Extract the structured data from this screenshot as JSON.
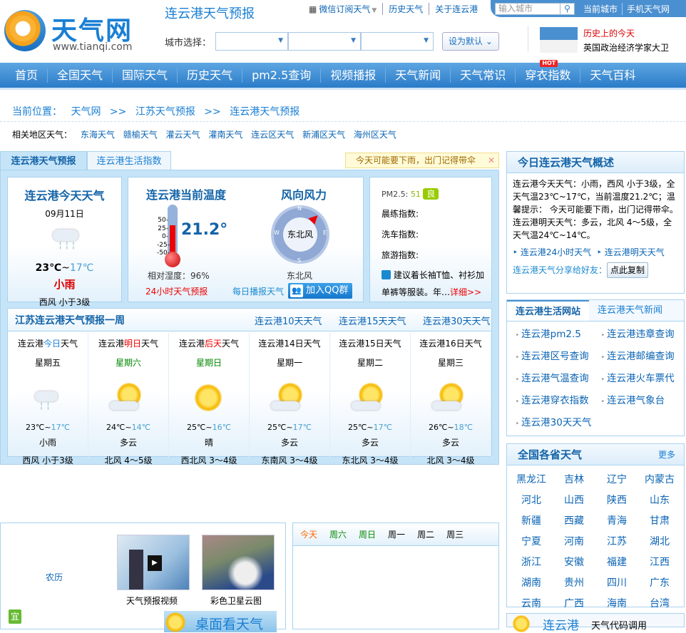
{
  "header": {
    "logo_text": "天气网",
    "logo_url": "www.tianqi.com",
    "title": "连云港天气预报",
    "top_links": [
      "微信订阅天气",
      "历史天气",
      "关于连云港"
    ],
    "search_placeholder": "输入城市",
    "current_city": "当前城市",
    "mobile": "手机天气网",
    "city_select_label": "城市选择：",
    "set_default": "设为默认",
    "history_title": "历史上的今天",
    "history_text": "英国政治经济学家大卫"
  },
  "nav": [
    "首页",
    "全国天气",
    "国际天气",
    "历史天气",
    "pm2.5查询",
    "视频播报",
    "天气新闻",
    "天气常识",
    "穿衣指数",
    "天气百科"
  ],
  "nav_hot": "HOT",
  "breadcrumb": {
    "label": "当前位置：",
    "items": [
      "天气网",
      ">>",
      "江苏天气预报",
      ">>",
      "连云港天气预报"
    ]
  },
  "related": {
    "label": "相关地区天气：",
    "items": [
      "东海天气",
      "赣榆天气",
      "灌云天气",
      "灌南天气",
      "连云区天气",
      "新浦区天气",
      "海州区天气"
    ]
  },
  "tabs": [
    "连云港天气预报",
    "连云港生活指数"
  ],
  "tip": "今天可能要下雨，出门记得带伞",
  "today": {
    "title": "连云港今天天气",
    "date": "09月11日",
    "high": "23℃",
    "sep": "~",
    "low": "17℃",
    "condition": "小雨",
    "wind": "西风 小于3级"
  },
  "current": {
    "title": "连云港当前温度",
    "temp": "21.2°",
    "scale": [
      "50-",
      "25-",
      "0-",
      "-25-",
      "-50-"
    ],
    "humidity": "相对湿度：96%",
    "link24": "24小时天气预报",
    "temp_fill": 0.6
  },
  "wind": {
    "title": "风向风力",
    "compass_n": "N",
    "compass_e": "E",
    "compass_s": "S",
    "compass_w": "W",
    "dir": "东北风",
    "label": "东北风",
    "daily": "每日播报天气",
    "qq": "加入QQ群"
  },
  "index": {
    "pm_label": "PM2.5:",
    "pm_value": "51",
    "pm_grade": "良",
    "items": [
      "晨练指数:",
      "洗车指数:",
      "旅游指数:"
    ],
    "dress": "建议着长袖T恤、衬衫加单裤等服装。年…",
    "detail": "详细>>"
  },
  "week": {
    "title": "江苏连云港天气预报一周",
    "links": [
      "连云港10天天气",
      "连云港15天天气",
      "连云港30天天气"
    ],
    "days": [
      {
        "pre": "连云港",
        "hl": "今日",
        "post": "天气",
        "hlcolor": "#1a7fd4",
        "weekday": "星期五",
        "wdcolor": "#000",
        "high": "23℃",
        "low": "17℃",
        "cond": "小雨",
        "wind": "西风 小于3级",
        "icon": "rain"
      },
      {
        "pre": "连云港",
        "hl": "明日",
        "post": "天气",
        "hlcolor": "#e00",
        "weekday": "星期六",
        "wdcolor": "#080",
        "high": "24℃",
        "low": "14℃",
        "cond": "多云",
        "wind": "北风 4～5级",
        "icon": "cloudy"
      },
      {
        "pre": "连云港",
        "hl": "后天",
        "post": "天气",
        "hlcolor": "#e00",
        "weekday": "星期日",
        "wdcolor": "#080",
        "high": "25℃",
        "low": "16℃",
        "cond": "晴",
        "wind": "西北风 3～4级",
        "icon": "sun"
      },
      {
        "pre": "连云港",
        "hl": "14日",
        "post": "天气",
        "hlcolor": "#000",
        "weekday": "星期一",
        "wdcolor": "#000",
        "high": "25℃",
        "low": "17℃",
        "cond": "多云",
        "wind": "东南风 3～4级",
        "icon": "cloudy"
      },
      {
        "pre": "连云港",
        "hl": "15日",
        "post": "天气",
        "hlcolor": "#000",
        "weekday": "星期二",
        "wdcolor": "#000",
        "high": "25℃",
        "low": "17℃",
        "cond": "多云",
        "wind": "东北风 3～4级",
        "icon": "cloudy"
      },
      {
        "pre": "连云港",
        "hl": "16日",
        "post": "天气",
        "hlcolor": "#000",
        "weekday": "星期三",
        "wdcolor": "#000",
        "high": "26℃",
        "low": "18℃",
        "cond": "多云",
        "wind": "北风 3～4级",
        "icon": "cloudy"
      }
    ]
  },
  "overview": {
    "title": "今日连云港天气概述",
    "text": "连云港今天天气：小雨，西风 小于3级，全天气温23℃~17℃，当前温度21.2℃；温馨提示： 今天可能要下雨，出门记得带伞。连云港明天天气：多云，北风 4～5级，全天气温24℃~14℃。",
    "links": [
      "连云港24小时天气",
      "连云港明天天气"
    ],
    "share": "连云港天气分享给好友：",
    "copy": "点此复制"
  },
  "life": {
    "tabs": [
      "连云港生活网站",
      "连云港天气新闻"
    ],
    "links": [
      "连云港pm2.5",
      "连云港违章查询",
      "连云港区号查询",
      "连云港邮编查询",
      "连云港气温查询",
      "连云港火车票代",
      "连云港穿衣指数",
      "连云港气象台",
      "连云港30天天气"
    ]
  },
  "provinces": {
    "title": "全国各省天气",
    "more": "更多",
    "items": [
      "黑龙江",
      "吉林",
      "辽宁",
      "内蒙古",
      "河北",
      "山西",
      "陕西",
      "山东",
      "新疆",
      "西藏",
      "青海",
      "甘肃",
      "宁夏",
      "河南",
      "江苏",
      "湖北",
      "浙江",
      "安徽",
      "福建",
      "江西",
      "湖南",
      "贵州",
      "四川",
      "广东",
      "云南",
      "广西",
      "海南",
      "台湾"
    ]
  },
  "bottom": {
    "lunar": "农历",
    "yi": "宜",
    "video": "天气预报视频",
    "satellite": "彩色卫星云图",
    "banner": "桌面看天气",
    "days": [
      "今天",
      "周六",
      "周日",
      "周一",
      "周二",
      "周三"
    ],
    "right_city": "连云港",
    "right_text": "天气代码调用"
  }
}
